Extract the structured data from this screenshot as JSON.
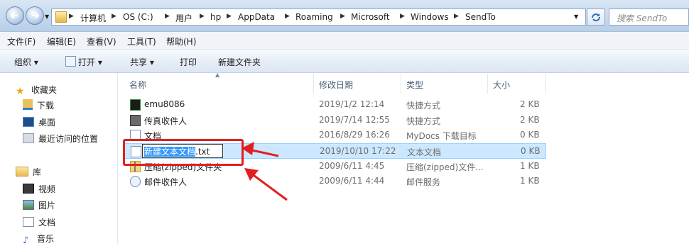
{
  "address": {
    "breadcrumbs": [
      "计算机",
      "OS (C:)",
      "用户",
      "hp",
      "AppData",
      "Roaming",
      "Microsoft",
      "Windows",
      "SendTo"
    ],
    "search_placeholder": "搜索 SendTo"
  },
  "menu": [
    "文件(F)",
    "编辑(E)",
    "查看(V)",
    "工具(T)",
    "帮助(H)"
  ],
  "toolbar": {
    "organize": "组织 ▾",
    "open": "打开 ▾",
    "share": "共享 ▾",
    "print": "打印",
    "new_folder": "新建文件夹"
  },
  "sidebar": {
    "favorites_header": "收藏夹",
    "favorites": [
      "下载",
      "桌面",
      "最近访问的位置"
    ],
    "library_header": "库",
    "library": [
      "视频",
      "图片",
      "文档",
      "音乐"
    ]
  },
  "columns": [
    "名称",
    "修改日期",
    "类型",
    "大小"
  ],
  "files": [
    {
      "name": "emu8086",
      "date": "2019/1/2 12:14",
      "type": "快捷方式",
      "size": "2 KB",
      "icon": "chip-shortcut-icon"
    },
    {
      "name": "传真收件人",
      "date": "2019/7/14 12:55",
      "type": "快捷方式",
      "size": "2 KB",
      "icon": "fax-icon"
    },
    {
      "name": "文档",
      "date": "2016/8/29 16:26",
      "type": "MyDocs 下载目标",
      "size": "0 KB",
      "icon": "document-icon"
    },
    {
      "name_selected": "新建文本文档",
      "name_ext": ".txt",
      "date": "2019/10/10 17:22",
      "type": "文本文档",
      "size": "0 KB",
      "icon": "text-file-icon"
    },
    {
      "name": "压缩(zipped)文件夹",
      "date": "2009/6/11 4:45",
      "type": "压缩(zipped)文件...",
      "size": "1 KB",
      "icon": "zip-folder-icon"
    },
    {
      "name": "邮件收件人",
      "date": "2009/6/11 4:44",
      "type": "邮件服务",
      "size": "1 KB",
      "icon": "mail-icon"
    }
  ],
  "colors": {
    "selection": "#cce8ff",
    "annotation": "#e02020",
    "highlight": "#3399ff"
  }
}
